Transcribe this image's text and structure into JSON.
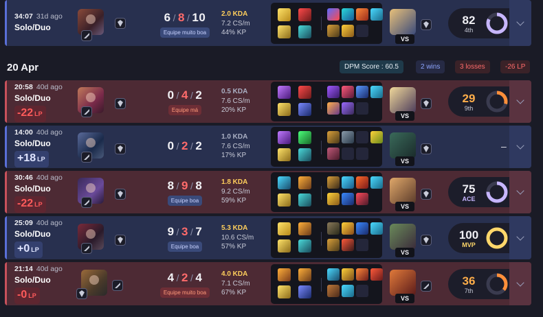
{
  "day": {
    "date": "20 Apr",
    "dpm": "DPM Score : 60.5",
    "wins": "2 wins",
    "losses": "3 losses",
    "lp": "-26 LP"
  },
  "matches": [
    {
      "result": "win",
      "time": "34:07",
      "ago": "31d ago",
      "queue": "Solo/Duo",
      "lp": "",
      "k": "6",
      "d": "8",
      "a": "10",
      "tag": "Equipe muito boa",
      "kda": "2.0 KDA",
      "cs": "7.2 CS/m",
      "kp": "44% KP",
      "score": "82",
      "rank": "4th",
      "score_pct": 0.82
    },
    {
      "result": "loss",
      "time": "20:58",
      "ago": "40d ago",
      "queue": "Solo/Duo",
      "lp": "-22",
      "k": "0",
      "d": "4",
      "a": "2",
      "tag": "Equipe má",
      "kda": "0.5 KDA",
      "cs": "7.6 CS/m",
      "kp": "20% KP",
      "score": "29",
      "rank": "9th",
      "score_pct": 0.29
    },
    {
      "result": "win",
      "time": "14:00",
      "ago": "40d ago",
      "queue": "Solo/Duo",
      "lp": "+18",
      "k": "0",
      "d": "2",
      "a": "2",
      "tag": "",
      "kda": "1.0 KDA",
      "cs": "7.6 CS/m",
      "kp": "17% KP",
      "score": "–",
      "rank": "",
      "score_pct": 0
    },
    {
      "result": "loss",
      "time": "30:46",
      "ago": "40d ago",
      "queue": "Solo/Duo",
      "lp": "-22",
      "k": "8",
      "d": "9",
      "a": "8",
      "tag": "Equipe boa",
      "kda": "1.8 KDA",
      "cs": "9.2 CS/m",
      "kp": "59% KP",
      "score": "75",
      "rank": "ACE",
      "score_pct": 0.75
    },
    {
      "result": "win",
      "time": "25:09",
      "ago": "40d ago",
      "queue": "Solo/Duo",
      "lp": "+0",
      "k": "9",
      "d": "3",
      "a": "7",
      "tag": "Equipe boa",
      "kda": "5.3 KDA",
      "cs": "10.6 CS/m",
      "kp": "57% KP",
      "score": "100",
      "rank": "MVP",
      "score_pct": 1.0
    },
    {
      "result": "loss",
      "time": "21:14",
      "ago": "40d ago",
      "queue": "Solo/Duo",
      "lp": "-0",
      "k": "4",
      "d": "2",
      "a": "4",
      "tag": "Equipe muito boa",
      "kda": "4.0 KDA",
      "cs": "7.1 CS/m",
      "kp": "67% KP",
      "score": "36",
      "rank": "7th",
      "score_pct": 0.36
    }
  ],
  "lp_unit": "LP",
  "vs_label": "VS",
  "colors": {
    "win": "#28304f",
    "loss": "#4d2a34",
    "ring_orange": "#ff8f3a",
    "ring_purple": "#c7b6ff",
    "ring_gold": "#ffd76a"
  }
}
